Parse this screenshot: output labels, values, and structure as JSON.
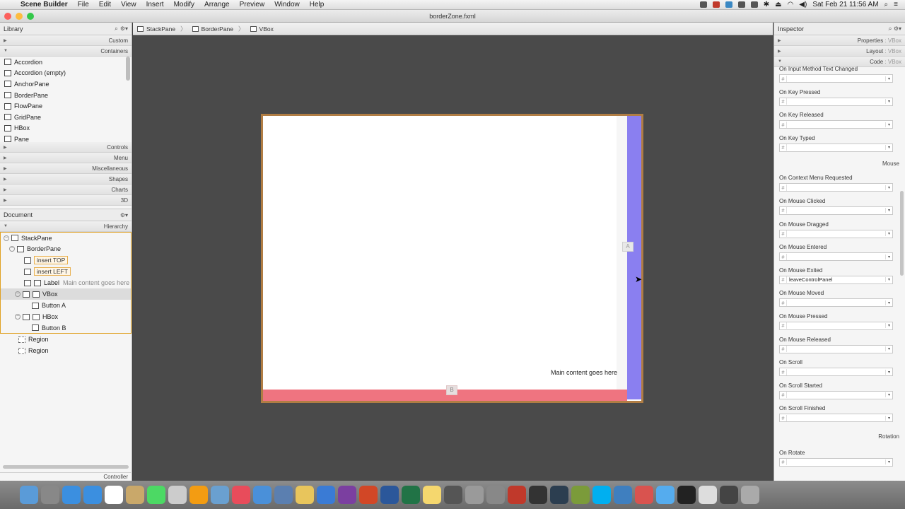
{
  "menubar": {
    "app_name": "Scene Builder",
    "items": [
      "File",
      "Edit",
      "View",
      "Insert",
      "Modify",
      "Arrange",
      "Preview",
      "Window",
      "Help"
    ],
    "clock": "Sat Feb 21  11:56 AM"
  },
  "window": {
    "title": "borderZone.fxml"
  },
  "library": {
    "title": "Library",
    "sections_top": [
      {
        "label": "Custom"
      },
      {
        "label": "Containers"
      }
    ],
    "items": [
      "Accordion",
      "Accordion  (empty)",
      "AnchorPane",
      "BorderPane",
      "FlowPane",
      "GridPane",
      "HBox",
      "Pane"
    ],
    "sections_bottom": [
      {
        "label": "Controls"
      },
      {
        "label": "Menu"
      },
      {
        "label": "Miscellaneous"
      },
      {
        "label": "Shapes"
      },
      {
        "label": "Charts"
      },
      {
        "label": "3D"
      }
    ]
  },
  "document": {
    "title": "Document",
    "hierarchy_label": "Hierarchy",
    "tree": {
      "stackpane": "StackPane",
      "borderpane": "BorderPane",
      "insert_top": "insert TOP",
      "insert_left": "insert LEFT",
      "label_type": "Label",
      "label_text": "Main content goes here",
      "vbox": "VBox",
      "button_a": "Button  A",
      "hbox": "HBox",
      "button_b": "Button  B",
      "region1": "Region",
      "region2": "Region"
    },
    "controller_label": "Controller"
  },
  "breadcrumb": [
    "StackPane",
    "BorderPane",
    "VBox"
  ],
  "canvas": {
    "button_a": "A",
    "button_b": "B",
    "main_label": "Main content goes here"
  },
  "inspector": {
    "title": "Inspector",
    "sections": [
      {
        "label": "Properties",
        "sub": " : VBox"
      },
      {
        "label": "Layout",
        "sub": " : VBox"
      },
      {
        "label": "Code",
        "sub": " : VBox"
      }
    ],
    "props_a": [
      {
        "label": "On Input Method Text Changed",
        "value": ""
      },
      {
        "label": "On Key Pressed",
        "value": ""
      },
      {
        "label": "On Key Released",
        "value": ""
      },
      {
        "label": "On Key Typed",
        "value": ""
      }
    ],
    "group_mouse": "Mouse",
    "props_b": [
      {
        "label": "On Context Menu Requested",
        "value": ""
      },
      {
        "label": "On Mouse Clicked",
        "value": ""
      },
      {
        "label": "On Mouse Dragged",
        "value": ""
      },
      {
        "label": "On Mouse Entered",
        "value": ""
      },
      {
        "label": "On Mouse Exited",
        "value": "leaveControlPanel"
      },
      {
        "label": "On Mouse Moved",
        "value": ""
      },
      {
        "label": "On Mouse Pressed",
        "value": ""
      },
      {
        "label": "On Mouse Released",
        "value": ""
      },
      {
        "label": "On Scroll",
        "value": ""
      },
      {
        "label": "On Scroll Started",
        "value": ""
      },
      {
        "label": "On Scroll Finished",
        "value": ""
      }
    ],
    "group_rotation": "Rotation",
    "props_c": [
      {
        "label": "On Rotate",
        "value": ""
      }
    ]
  },
  "dock": {
    "apps": [
      "finder",
      "launchpad",
      "app-store",
      "safari",
      "calendar",
      "notes",
      "messages",
      "help",
      "ibooks",
      "preview",
      "itunes",
      "keynote",
      "xcode",
      "photos",
      "chat",
      "onenote",
      "powerpoint",
      "word",
      "excel",
      "notes2",
      "mission-control",
      "screenshot",
      "settings",
      "mail",
      "console",
      "eclipse",
      "cocoa",
      "skype",
      "scene-builder",
      "parallels",
      "twitter",
      "terminal",
      "editor",
      "warning",
      "trash"
    ]
  }
}
